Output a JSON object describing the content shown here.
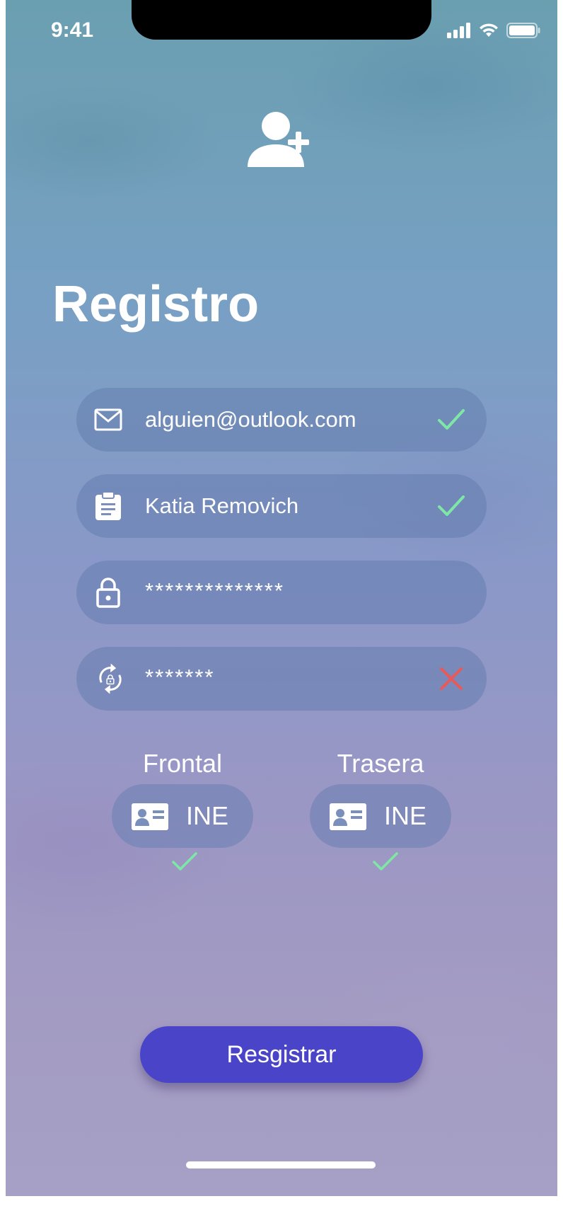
{
  "status_bar": {
    "time": "9:41",
    "icons": [
      "cellular-signal-icon",
      "wifi-icon",
      "battery-icon"
    ]
  },
  "header": {
    "icon": "add-user-icon",
    "title": "Registro"
  },
  "form": {
    "fields": [
      {
        "icon": "mail-icon",
        "value": "alguien@outlook.com",
        "status": "valid"
      },
      {
        "icon": "clipboard-icon",
        "value": "Katia Removich",
        "status": "valid"
      },
      {
        "icon": "lock-icon",
        "value": "**************",
        "status": "none"
      },
      {
        "icon": "lock-refresh-icon",
        "value": "*******",
        "status": "invalid"
      }
    ]
  },
  "id_upload": {
    "front": {
      "label": "Frontal",
      "button_text": "INE",
      "icon": "id-card-icon",
      "status": "valid"
    },
    "back": {
      "label": "Trasera",
      "button_text": "INE",
      "icon": "id-card-icon",
      "status": "valid"
    }
  },
  "actions": {
    "register_label": "Resgistrar"
  },
  "colors": {
    "valid": "#7fe7a6",
    "invalid": "#e85a5a",
    "primary": "#4a45c8",
    "field_bg": "rgba(100,125,175,0.55)"
  }
}
